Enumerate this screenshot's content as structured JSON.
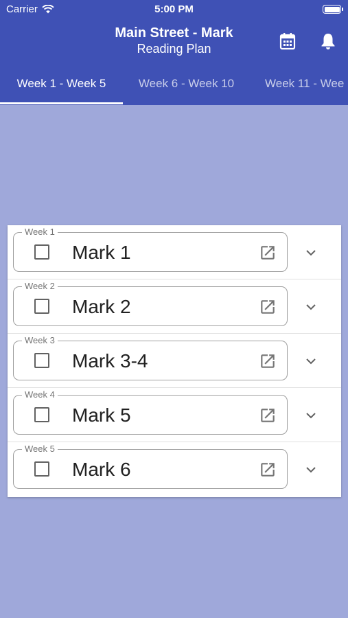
{
  "status_bar": {
    "carrier": "Carrier",
    "time": "5:00 PM"
  },
  "header": {
    "title": "Main Street - Mark",
    "subtitle": "Reading Plan",
    "actions": [
      "calendar-icon",
      "bell-icon"
    ]
  },
  "tabs": [
    {
      "label": "Week 1 - Week 5",
      "selected": true
    },
    {
      "label": "Week 6 - Week 10",
      "selected": false
    },
    {
      "label": "Week 11 - Wee",
      "selected": false
    }
  ],
  "readings": [
    {
      "week": "Week 1",
      "passage": "Mark 1",
      "checked": false
    },
    {
      "week": "Week 2",
      "passage": "Mark 2",
      "checked": false
    },
    {
      "week": "Week 3",
      "passage": "Mark 3-4",
      "checked": false
    },
    {
      "week": "Week 4",
      "passage": "Mark 5",
      "checked": false
    },
    {
      "week": "Week 5",
      "passage": "Mark 6",
      "checked": false
    }
  ],
  "colors": {
    "app_bar": "#3F51B5",
    "background": "#9FA8DA",
    "card": "#FFFFFF"
  }
}
